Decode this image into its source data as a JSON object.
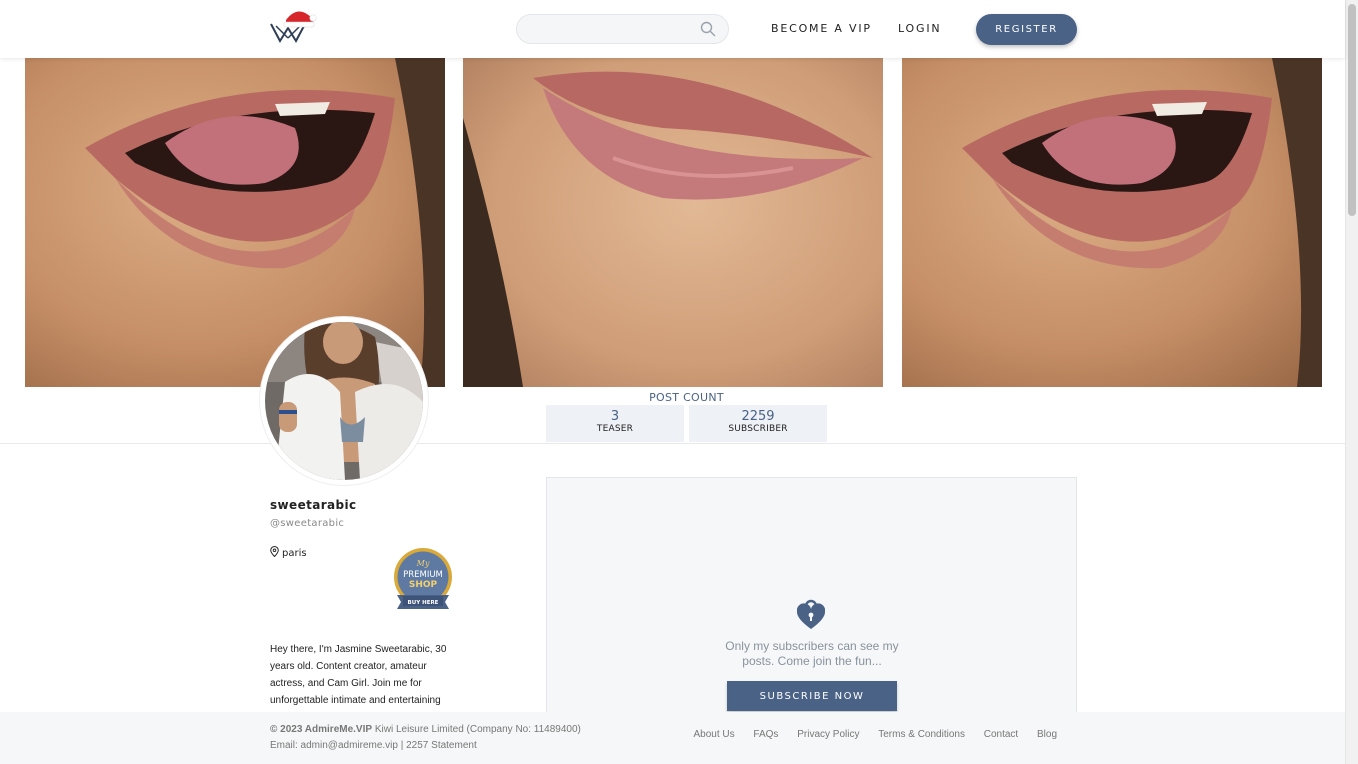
{
  "header": {
    "search_placeholder": "",
    "nav_vip": "BECOME A VIP",
    "nav_login": "LOGIN",
    "register_label": "REGISTER"
  },
  "stats": {
    "title": "POST COUNT",
    "teaser_count": "3",
    "teaser_label": "TEASER",
    "subscriber_count": "2259",
    "subscriber_label": "SUBSCRIBER"
  },
  "profile": {
    "username": "sweetarabic",
    "handle": "@sweetarabic",
    "location": "paris",
    "badge": {
      "line1": "My",
      "line2": "PREMIUM",
      "line3": "SHOP",
      "ribbon": "BUY HERE"
    },
    "bio": "Hey there, I'm Jasmine Sweetarabic, 30 years old. Content creator, amateur actress, and Cam Girl. Join me for unforgettable intimate and entertaining"
  },
  "locked": {
    "message": "Only my subscribers can see my posts. Come join the fun...",
    "subscribe_label": "SUBSCRIBE NOW"
  },
  "footer": {
    "copyright_bold": "© 2023 AdmireMe.VIP",
    "company": "Kiwi Leisure Limited (Company No: 11489400)",
    "email_line": "Email: admin@admireme.vip | 2257 Statement",
    "links": [
      "About Us",
      "FAQs",
      "Privacy Policy",
      "Terms & Conditions",
      "Contact",
      "Blog"
    ]
  },
  "colors": {
    "accent": "#4a6286",
    "panel_bg": "#f5f7f9",
    "badge_gold": "#d9a93a"
  },
  "icons": [
    "admireme-logo-icon",
    "search-icon",
    "location-pin-icon",
    "heart-lock-icon"
  ]
}
